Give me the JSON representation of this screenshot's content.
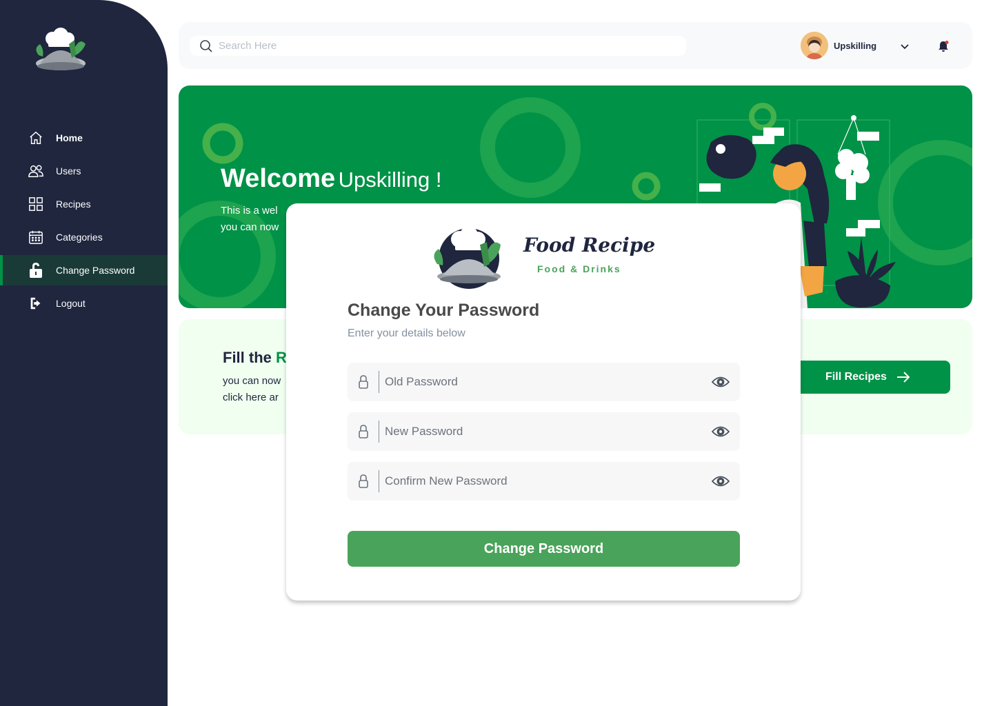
{
  "sidebar": {
    "items": [
      {
        "label": "Home",
        "icon": "home-icon"
      },
      {
        "label": "Users",
        "icon": "users-icon"
      },
      {
        "label": "Recipes",
        "icon": "recipes-grid-icon"
      },
      {
        "label": "Categories",
        "icon": "calendar-icon"
      },
      {
        "label": "Change Password",
        "icon": "unlock-icon"
      },
      {
        "label": "Logout",
        "icon": "logout-icon"
      }
    ]
  },
  "header": {
    "search_placeholder": "Search Here",
    "username": "Upskilling"
  },
  "hero": {
    "title_bold": "Welcome",
    "title_name": "Upskilling !",
    "line1": "This is a wel",
    "line2": "you can now"
  },
  "fill_card": {
    "title_plain": "Fill the ",
    "title_green": "R",
    "line1": "you can now",
    "line2": "click here ar",
    "button_label": "Fill Recipes"
  },
  "modal": {
    "brand": "Food Recipe",
    "brand_sub": "Food & Drinks",
    "title": "Change Your Password",
    "subtitle": "Enter your details below",
    "old_placeholder": "Old Password",
    "new_placeholder": "New Password",
    "confirm_placeholder": "Confirm New Password",
    "submit_label": "Change Password"
  },
  "colors": {
    "sidebar": "#1f263e",
    "brand_green": "#009247",
    "button_green": "#4aa35a",
    "light_green": "#f0fff0"
  }
}
